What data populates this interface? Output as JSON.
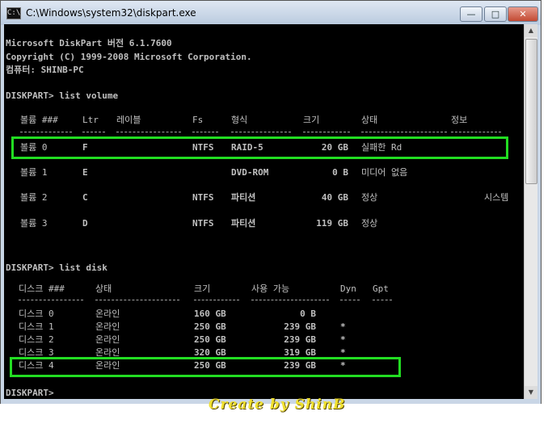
{
  "window": {
    "title": "C:\\Windows\\system32\\diskpart.exe",
    "icon_label": "C:\\",
    "controls": {
      "minimize": "—",
      "maximize": "□",
      "close": "✕"
    }
  },
  "console": {
    "banner": [
      "Microsoft DiskPart 버전 6.1.7600",
      "Copyright (C) 1999-2008 Microsoft Corporation.",
      "컴퓨터: SHINB-PC"
    ],
    "cmd_list_volume": "DISKPART> list volume",
    "volume_headers": [
      "볼륨 ###",
      "Ltr",
      "레이블",
      "Fs",
      "형식",
      "크기",
      "상태",
      "정보"
    ],
    "volume_rows": [
      {
        "num": "볼륨 0",
        "ltr": "F",
        "label": "",
        "fs": "NTFS",
        "type": "RAID-5",
        "size": "20 GB",
        "status": "실패한 Rd",
        "info": ""
      },
      {
        "num": "볼륨 1",
        "ltr": "E",
        "label": "",
        "fs": "",
        "type": "DVD-ROM",
        "size": "0 B",
        "status": "미디어 없음",
        "info": ""
      },
      {
        "num": "볼륨 2",
        "ltr": "C",
        "label": "",
        "fs": "NTFS",
        "type": "파티션",
        "size": "40 GB",
        "status": "정상",
        "info": "시스템"
      },
      {
        "num": "볼륨 3",
        "ltr": "D",
        "label": "",
        "fs": "NTFS",
        "type": "파티션",
        "size": "119 GB",
        "status": "정상",
        "info": ""
      }
    ],
    "cmd_list_disk": "DISKPART> list disk",
    "disk_headers": [
      "디스크 ###",
      "상태",
      "크기",
      "사용 가능",
      "Dyn",
      "Gpt"
    ],
    "disk_rows": [
      {
        "num": "디스크 0",
        "status": "온라인",
        "size": "160 GB",
        "free": "0 B",
        "dyn": "",
        "gpt": ""
      },
      {
        "num": "디스크 1",
        "status": "온라인",
        "size": "250 GB",
        "free": "239 GB",
        "dyn": "*",
        "gpt": ""
      },
      {
        "num": "디스크 2",
        "status": "온라인",
        "size": "250 GB",
        "free": "239 GB",
        "dyn": "*",
        "gpt": ""
      },
      {
        "num": "디스크 3",
        "status": "온라인",
        "size": "320 GB",
        "free": "319 GB",
        "dyn": "*",
        "gpt": ""
      },
      {
        "num": "디스크 4",
        "status": "온라인",
        "size": "250 GB",
        "free": "239 GB",
        "dyn": "*",
        "gpt": ""
      }
    ],
    "prompt": "DISKPART>"
  },
  "watermark": "Create by ShinB",
  "colors": {
    "console_bg": "#000000",
    "console_text": "#c0c0c0",
    "highlight": "#22dd22",
    "watermark": "#f0e030"
  }
}
